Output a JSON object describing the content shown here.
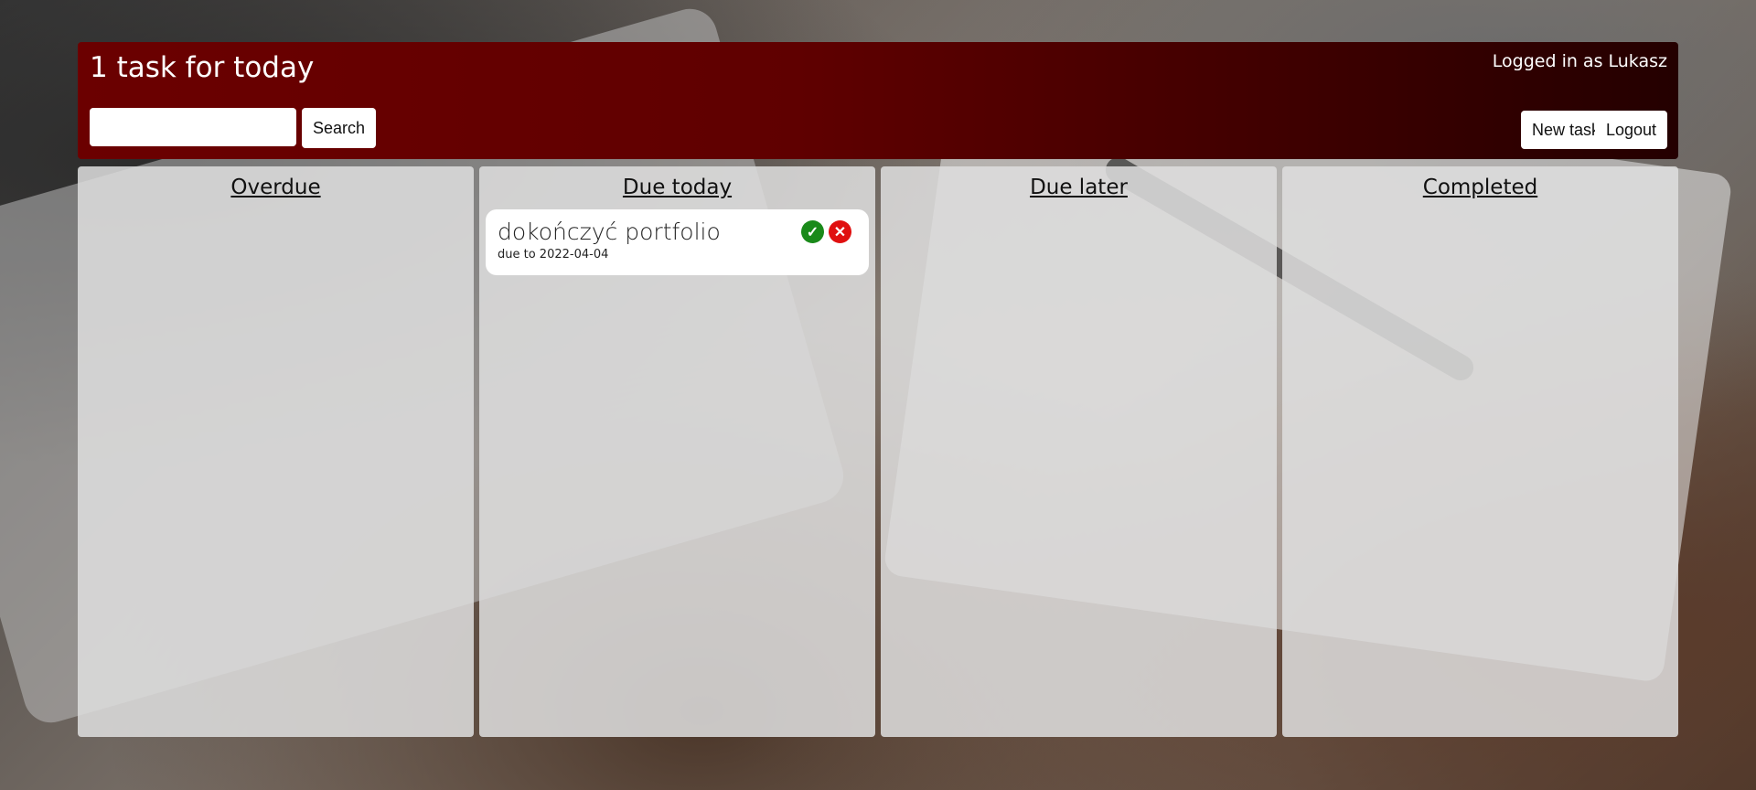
{
  "header": {
    "title": "1 task for today",
    "user_status": "Logged in as Lukasz",
    "search_button": "Search",
    "search_placeholder": "",
    "new_task_button": "New task",
    "logout_button": "Logout"
  },
  "columns": [
    {
      "title": "Overdue",
      "tasks": []
    },
    {
      "title": "Due today",
      "tasks": [
        {
          "title": "dokończyć portfolio",
          "due": "due to 2022-04-04",
          "complete_icon": "✓",
          "delete_icon": "✕"
        }
      ]
    },
    {
      "title": "Due later",
      "tasks": []
    },
    {
      "title": "Completed",
      "tasks": []
    }
  ],
  "colors": {
    "header_start": "#6b0000",
    "header_end": "#240000",
    "complete": "#1a8a1a",
    "delete": "#e01010"
  },
  "icons": {
    "complete": "check-icon",
    "delete": "close-icon"
  }
}
